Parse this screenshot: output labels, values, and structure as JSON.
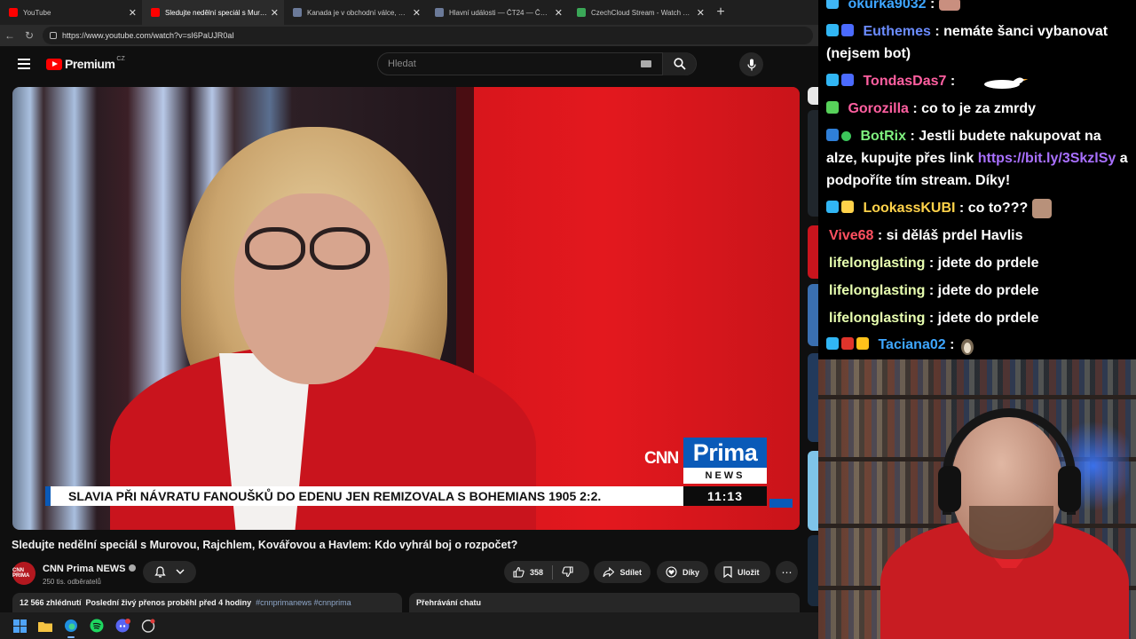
{
  "browser": {
    "tabs": [
      {
        "title": "YouTube",
        "active": false,
        "color": "#ff0000"
      },
      {
        "title": "Sledujte nedělní speciál s Murovou, R",
        "active": true,
        "color": "#ff0000"
      },
      {
        "title": "Kanada je v obchodní válce, nebo",
        "active": false,
        "color": "#6b7a99"
      },
      {
        "title": "Hlavní události — ČT24 — Česká t",
        "active": false,
        "color": "#6b7a99"
      },
      {
        "title": "CzechCloud Stream - Watch Live o",
        "active": false,
        "color": "#3aa757"
      }
    ],
    "url": "https://www.youtube.com/watch?v=sI6PaUJR0aI"
  },
  "youtube": {
    "logo_text": "Premium",
    "region": "CZ",
    "search_placeholder": "Hledat"
  },
  "video": {
    "ticker": "SLAVIA PŘI NÁVRATU FANOUŠKŮ DO EDENU JEN REMIZOVALA S BOHEMIANS 1905 2:2.",
    "clock": "11:13",
    "logo_cnn": "CNN",
    "logo_prima": "Prima",
    "logo_news": "NEWS",
    "title": "Sledujte nedělní speciál s Murovou, Rajchlem, Kovářovou a Havlem: Kdo vyhrál boj o rozpočet?"
  },
  "channel": {
    "name": "CNN Prima NEWS",
    "subscribers": "250 tis. odběratelů",
    "avatar_text": "CNN PRIMA"
  },
  "actions": {
    "likes": "358",
    "share": "Sdílet",
    "thanks": "Díky",
    "save": "Uložit"
  },
  "description": {
    "views": "12 566 zhlédnutí",
    "info": "Poslední živý přenos proběhl před 4 hodiny",
    "tags": "#cnnprimanews #cnnprima"
  },
  "chat_replay_label": "Přehrávání chatu",
  "stream_chat": [
    {
      "user": "okurka9032",
      "text": "",
      "color": "#3ea6ff",
      "badges": [
        "#3fb6f5"
      ]
    },
    {
      "user": "Euthemes",
      "text": "nemáte šanci vybanovat (nejsem bot)",
      "color": "#6b8cff",
      "badges": [
        "#31b6f4",
        "#4b6bff"
      ]
    },
    {
      "user": "TondasDas7",
      "text": "",
      "color": "#ff5fa0",
      "badges": [
        "#31b6f4",
        "#4b6bff"
      ]
    },
    {
      "user": "Gorozilla",
      "text": "co to je za zmrdy",
      "color": "#ff5fa0",
      "badges": [
        "#57d15a"
      ]
    },
    {
      "user": "BotRix",
      "text": "Jestli budete nakupovat na alze, kupujte přes link",
      "link": "https://bit.ly/3SkzlSy",
      "tail": "a podpoříte tím stream. Díky!",
      "color": "#7ff07f",
      "badges": [
        "#2f7fd8",
        "#3cc55a"
      ]
    },
    {
      "user": "LookassKUBI",
      "text": "co to???",
      "color": "#ffd24a",
      "badges": [
        "#31b6f4",
        "#ffd24a"
      ]
    },
    {
      "user": "Vive68",
      "text": "si děláš prdel Havlis",
      "color": "#ff5060",
      "badges": []
    },
    {
      "user": "lifelonglasting",
      "text": "jdete do prdele",
      "color": "#e8ffb0",
      "badges": []
    },
    {
      "user": "lifelonglasting",
      "text": "jdete do prdele",
      "color": "#e8ffb0",
      "badges": []
    },
    {
      "user": "lifelonglasting",
      "text": "jdete do prdele",
      "color": "#e8ffb0",
      "badges": []
    },
    {
      "user": "Taciana02",
      "text": "",
      "color": "#3ea6ff",
      "badges": [
        "#31b6f4",
        "#e0342b",
        "#ffc21a"
      ]
    }
  ]
}
